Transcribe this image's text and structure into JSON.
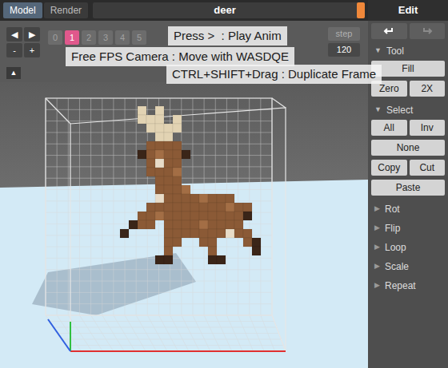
{
  "tabs": [
    {
      "label": "Model",
      "selected": true
    },
    {
      "label": "Render",
      "selected": false
    }
  ],
  "document": {
    "title": "deer"
  },
  "panel": {
    "title": "Edit"
  },
  "history": {
    "undo_disabled": false,
    "redo_disabled": true
  },
  "timeline": {
    "nav": [
      "◀",
      "▶",
      "-",
      "+"
    ],
    "frames": [
      {
        "label": "0",
        "selected": false
      },
      {
        "label": "1",
        "selected": true
      },
      {
        "label": "2",
        "selected": false
      },
      {
        "label": "3",
        "selected": false
      },
      {
        "label": "4",
        "selected": false
      },
      {
        "label": "5",
        "selected": false
      }
    ],
    "step": "step",
    "count": "120",
    "collapse": "▲"
  },
  "tooltips": [
    "Press >  : Play Anim",
    "Free FPS Camera : Move with WASDQE",
    "CTRL+SHIFT+Drag : Duplicate Frame"
  ],
  "sections": [
    {
      "arrow": "▼",
      "label": "Tool",
      "expanded": true,
      "rows": [
        [
          "Fill"
        ],
        [
          "Zero",
          "2X"
        ]
      ]
    },
    {
      "arrow": "▼",
      "label": "Select",
      "expanded": true,
      "rows": [
        [
          "All",
          "Inv"
        ],
        [
          "None"
        ],
        [
          "Copy",
          "Cut"
        ],
        [
          "Paste"
        ]
      ]
    },
    {
      "arrow": "▶",
      "label": "Rot",
      "expanded": false,
      "rows": []
    },
    {
      "arrow": "▶",
      "label": "Flip",
      "expanded": false,
      "rows": []
    },
    {
      "arrow": "▶",
      "label": "Loop",
      "expanded": false,
      "rows": []
    },
    {
      "arrow": "▶",
      "label": "Scale",
      "expanded": false,
      "rows": []
    },
    {
      "arrow": "▶",
      "label": "Repeat",
      "expanded": false,
      "rows": []
    }
  ]
}
